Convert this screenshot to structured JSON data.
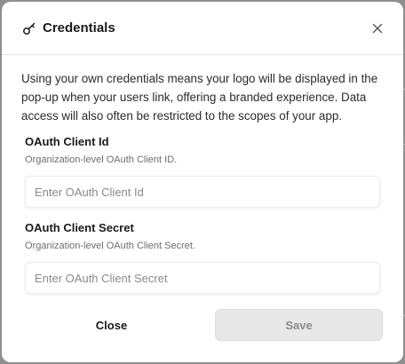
{
  "modal": {
    "title": "Credentials",
    "intro": "Using your own credentials means your logo will be displayed in the pop-up when your users link, offering a branded experience. Data access will also often be restricted to the scopes of your app.",
    "title_icon": "key-icon",
    "close_icon": "close-icon"
  },
  "fields": {
    "client_id": {
      "label": "OAuth Client Id",
      "description": "Organization-level OAuth Client ID.",
      "value": "",
      "placeholder": "Enter OAuth Client Id"
    },
    "client_secret": {
      "label": "OAuth Client Secret",
      "description": "Organization-level OAuth Client Secret.",
      "value": "",
      "placeholder": "Enter OAuth Client Secret"
    }
  },
  "footer": {
    "close_label": "Close",
    "save_label": "Save"
  },
  "colors": {
    "overlay": "#8f8f8f",
    "save_bg": "#e8e8e8",
    "save_text": "#8c8c8c"
  }
}
